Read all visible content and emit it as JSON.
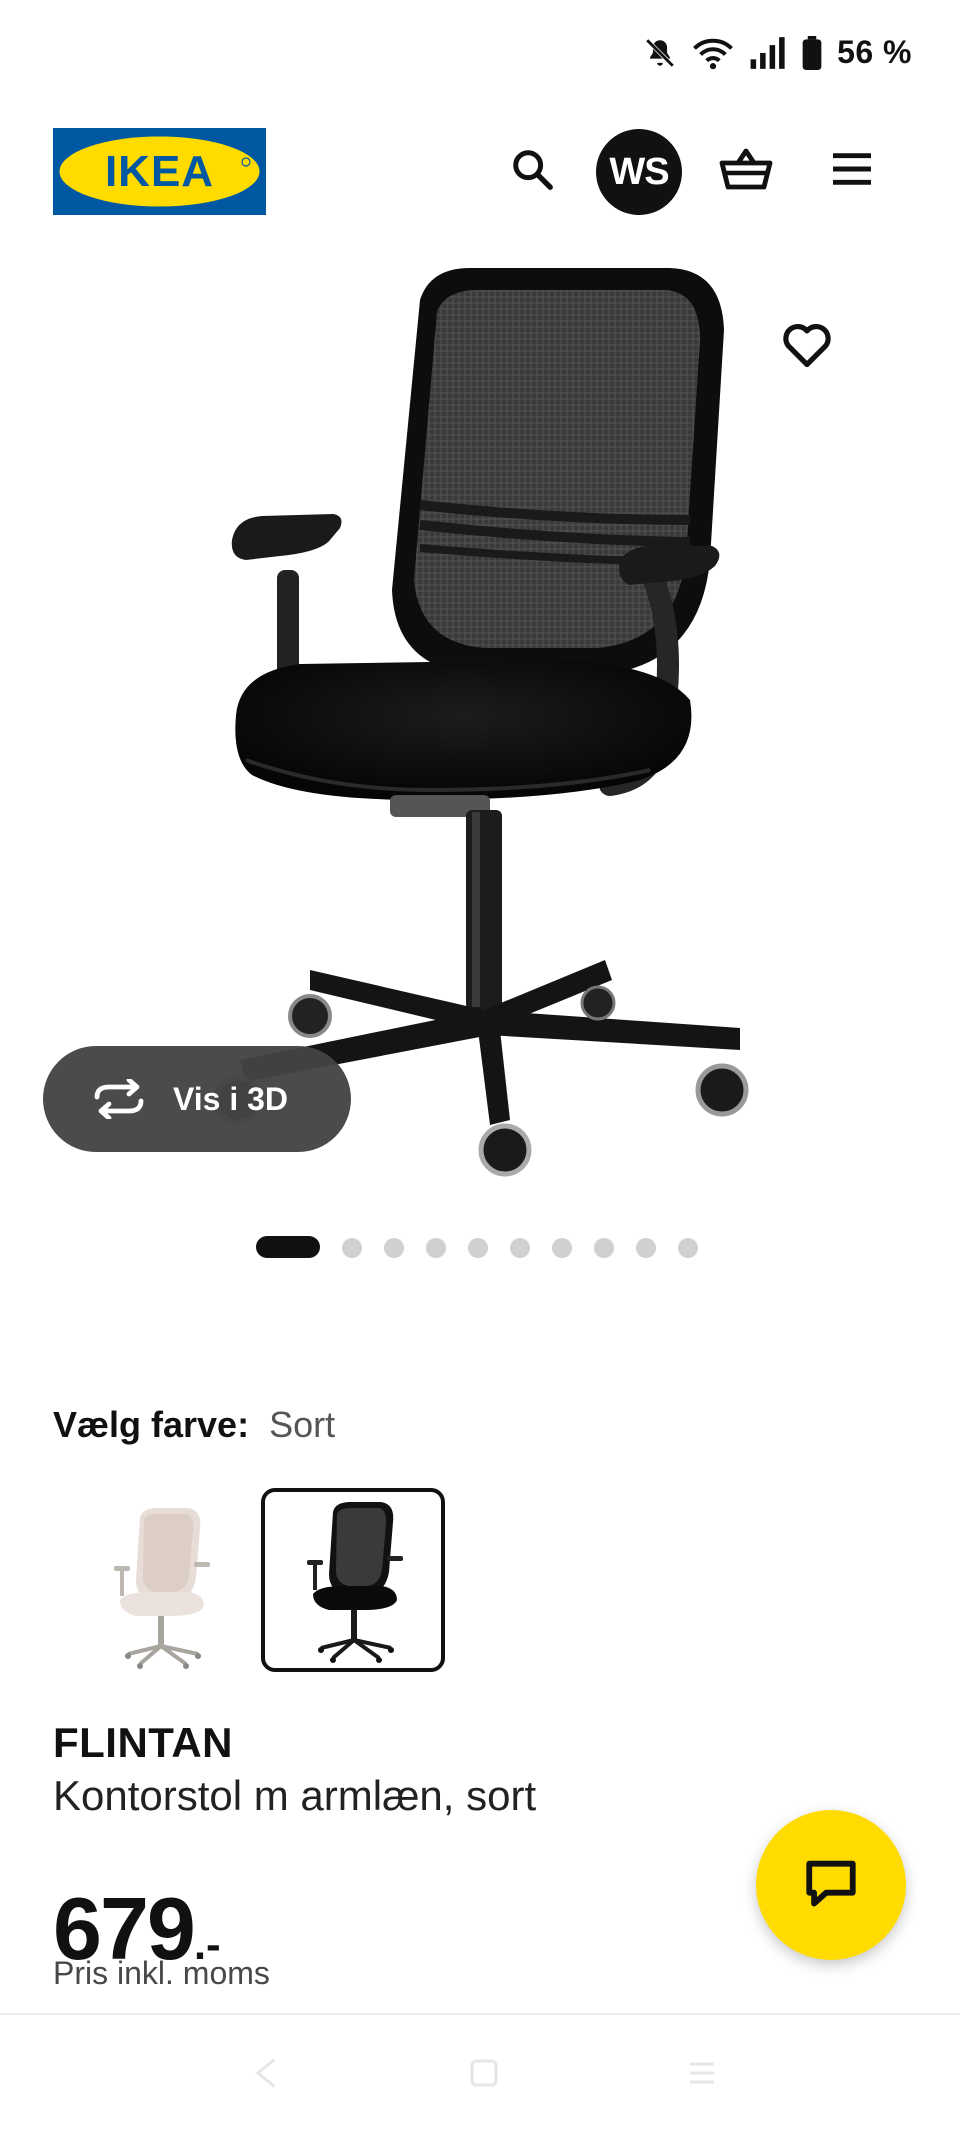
{
  "status_bar": {
    "battery": "56 %",
    "icons": [
      "bell-muted-icon",
      "wifi-icon",
      "signal-icon",
      "battery-icon"
    ]
  },
  "header": {
    "logo_text": "IKEA",
    "avatar_initials": "WS",
    "icons": [
      "search-icon",
      "basket-icon",
      "menu-icon"
    ]
  },
  "gallery": {
    "view_3d_label": "Vis i 3D",
    "dot_count": 10,
    "active_dot": 1
  },
  "color_chooser": {
    "label": "Vælg farve:",
    "selected": "Sort",
    "options": [
      "beige",
      "sort"
    ]
  },
  "product": {
    "name": "FLINTAN",
    "description": "Kontorstol m armlæn, sort",
    "price": "679",
    "price_suffix": ".-",
    "price_note": "Pris inkl. moms"
  },
  "colors": {
    "brand_blue": "#0058a3",
    "brand_yellow": "#ffdb00"
  }
}
